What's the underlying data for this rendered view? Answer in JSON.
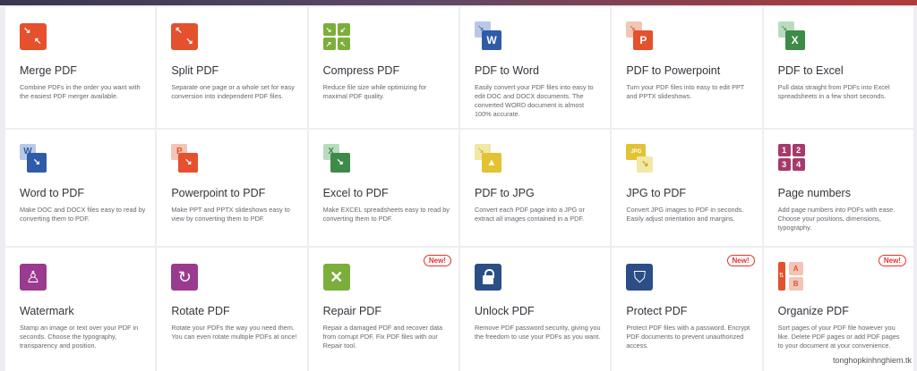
{
  "tools": [
    {
      "title": "Merge PDF",
      "desc": "Combine PDFs in the order you want with the easiest PDF merger available.",
      "icon": "merge-icon",
      "color": "#e5512d"
    },
    {
      "title": "Split PDF",
      "desc": "Separate one page or a whole set for easy conversion into independent PDF files.",
      "icon": "split-icon",
      "color": "#e5512d"
    },
    {
      "title": "Compress PDF",
      "desc": "Reduce file size while optimizing for maximal PDF quality.",
      "icon": "compress-icon",
      "color": "#7bae3a"
    },
    {
      "title": "PDF to Word",
      "desc": "Easily convert your PDF files into easy to edit DOC and DOCX documents. The converted WORD document is almost 100% accurate.",
      "icon": "pdf-to-word-icon",
      "color": "#2f5ba8",
      "back": "#b8c9e8",
      "letter": "W"
    },
    {
      "title": "PDF to Powerpoint",
      "desc": "Turn your PDF files into easy to edit PPT and PPTX slideshows.",
      "icon": "pdf-to-powerpoint-icon",
      "color": "#e5512d",
      "back": "#f3c5b5",
      "letter": "P"
    },
    {
      "title": "PDF to Excel",
      "desc": "Pull data straight from PDFs into Excel spreadsheets in a few short seconds.",
      "icon": "pdf-to-excel-icon",
      "color": "#3d8a49",
      "back": "#b9dcbf",
      "letter": "X"
    },
    {
      "title": "Word to PDF",
      "desc": "Make DOC and DOCX files easy to read by converting them to PDF.",
      "icon": "word-to-pdf-icon",
      "color": "#2f5ba8",
      "back": "#b8c9e8",
      "letter": "W"
    },
    {
      "title": "Powerpoint to PDF",
      "desc": "Make PPT and PPTX slideshows easy to view by converting them to PDF.",
      "icon": "powerpoint-to-pdf-icon",
      "color": "#e5512d",
      "back": "#f3c5b5",
      "letter": "P"
    },
    {
      "title": "Excel to PDF",
      "desc": "Make EXCEL spreadsheets easy to read by converting them to PDF.",
      "icon": "excel-to-pdf-icon",
      "color": "#3d8a49",
      "back": "#b9dcbf",
      "letter": "X"
    },
    {
      "title": "PDF to JPG",
      "desc": "Convert each PDF page into a JPG or extract all images contained in a PDF.",
      "icon": "pdf-to-jpg-icon",
      "color": "#e3c233",
      "back": "#f3e7a5",
      "letter": "▲"
    },
    {
      "title": "JPG to PDF",
      "desc": "Convert JPG images to PDF in seconds. Easily adjust orientation and margins.",
      "icon": "jpg-to-pdf-icon",
      "color": "#e3c233",
      "back": "#f3e7a5",
      "letter": "JPG"
    },
    {
      "title": "Page numbers",
      "desc": "Add page numbers into PDFs with ease. Choose your positions, dimensions, typography.",
      "icon": "page-numbers-icon",
      "color": "#a63a6a"
    },
    {
      "title": "Watermark",
      "desc": "Stamp an image or text over your PDF in seconds. Choose the typography, transparency and position.",
      "icon": "watermark-icon",
      "color": "#9a3b8f",
      "glyph": "♙"
    },
    {
      "title": "Rotate PDF",
      "desc": "Rotate your PDFs the way you need them. You can even rotate multiple PDFs at once!",
      "icon": "rotate-icon",
      "color": "#9a3b8f",
      "glyph": "↻"
    },
    {
      "title": "Repair PDF",
      "desc": "Repair a damaged PDF and recover data from corrupt PDF. Fix PDF files with our Repair tool.",
      "icon": "repair-icon",
      "color": "#7bae3a",
      "glyph": "✕",
      "badge": "New!"
    },
    {
      "title": "Unlock PDF",
      "desc": "Remove PDF password security, giving you the freedom to use your PDFs as you want.",
      "icon": "unlock-icon",
      "color": "#2c4e86",
      "glyph": "🔓"
    },
    {
      "title": "Protect PDF",
      "desc": "Protect PDF files with a password. Encrypt PDF documents to prevent unauthorized access.",
      "icon": "protect-icon",
      "color": "#2c4e86",
      "glyph": "⛉",
      "badge": "New!"
    },
    {
      "title": "Organize PDF",
      "desc": "Sort pages of your PDF file however you like. Delete PDF pages or add PDF pages to your document at your convenience.",
      "icon": "organize-icon",
      "color": "#e5512d",
      "badge": "New!"
    }
  ],
  "page_numbers": [
    "1",
    "2",
    "3",
    "4"
  ],
  "organize_letters": [
    "A",
    "B"
  ],
  "watermark": "tonghopkinhnghiem.tk"
}
